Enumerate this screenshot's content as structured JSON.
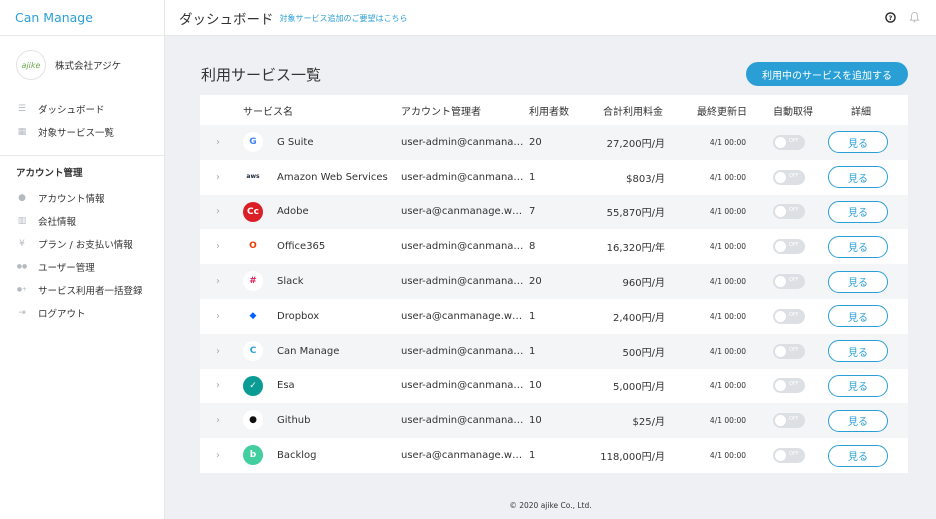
{
  "sidebar": {
    "brand": "Can Manage",
    "company_logo_text": "ajike",
    "company_name": "株式会社アジケ",
    "nav_main": [
      {
        "label": "ダッシュボード",
        "icon": "list-icon"
      },
      {
        "label": "対象サービス一覧",
        "icon": "grid-icon"
      }
    ],
    "account_section_title": "アカウント管理",
    "nav_account": [
      {
        "label": "アカウント情報",
        "icon": "user-icon"
      },
      {
        "label": "会社情報",
        "icon": "building-icon"
      },
      {
        "label": "プラン / お支払い情報",
        "icon": "yen-icon"
      },
      {
        "label": "ユーザー管理",
        "icon": "users-icon"
      },
      {
        "label": "サービス利用者一括登録",
        "icon": "user-plus-icon"
      },
      {
        "label": "ログアウト",
        "icon": "logout-icon"
      }
    ]
  },
  "header": {
    "title": "ダッシュボード",
    "request_link": "対象サービス追加のご要望はこちら",
    "icons": [
      "help-icon",
      "bell-icon"
    ]
  },
  "main": {
    "title": "利用サービス一覧",
    "add_button": "利用中のサービスを追加する",
    "columns": {
      "service": "サービス名",
      "admin": "アカウント管理者",
      "users": "利用者数",
      "price": "合計利用料金",
      "updated": "最終更新日",
      "auto": "自動取得",
      "detail": "詳細"
    },
    "toggle_label": "OFF",
    "detail_label": "見る",
    "rows": [
      {
        "name": "G Suite",
        "icon": "google-icon",
        "icon_char": "G",
        "icon_color": "#4285f4",
        "icon_bg": "#ffffff",
        "admin": "user-admin@canmanage.work",
        "users": "20",
        "price": "27,200円/月",
        "updated": "4/1 00:00"
      },
      {
        "name": "Amazon Web Services",
        "icon": "aws-icon",
        "icon_char": "aws",
        "icon_color": "#232f3e",
        "icon_bg": "#ffffff",
        "admin": "user-admin@canmanage.work",
        "users": "1",
        "price": "$803/月",
        "updated": "4/1 00:00"
      },
      {
        "name": "Adobe",
        "icon": "adobe-icon",
        "icon_char": "Cc",
        "icon_color": "#ffffff",
        "icon_bg": "#da1f26",
        "admin": "user-a@canmanage.work",
        "users": "7",
        "price": "55,870円/月",
        "updated": "4/1 00:00"
      },
      {
        "name": "Office365",
        "icon": "office365-icon",
        "icon_char": "O",
        "icon_color": "#eb3c00",
        "icon_bg": "#ffffff",
        "admin": "user-admin@canmanage.work",
        "users": "8",
        "price": "16,320円/年",
        "updated": "4/1 00:00"
      },
      {
        "name": "Slack",
        "icon": "slack-icon",
        "icon_char": "#",
        "icon_color": "#e01e5a",
        "icon_bg": "#ffffff",
        "admin": "user-admin@canmanage.work",
        "users": "20",
        "price": "960円/月",
        "updated": "4/1 00:00"
      },
      {
        "name": "Dropbox",
        "icon": "dropbox-icon",
        "icon_char": "◆",
        "icon_color": "#0061ff",
        "icon_bg": "#ffffff",
        "admin": "user-a@canmanage.work",
        "users": "1",
        "price": "2,400円/月",
        "updated": "4/1 00:00"
      },
      {
        "name": "Can Manage",
        "icon": "canmanage-icon",
        "icon_char": "C",
        "icon_color": "#2a9fd6",
        "icon_bg": "#ffffff",
        "admin": "user-admin@canmanage.work",
        "users": "1",
        "price": "500円/月",
        "updated": "4/1 00:00"
      },
      {
        "name": "Esa",
        "icon": "esa-icon",
        "icon_char": "✓",
        "icon_color": "#ffffff",
        "icon_bg": "#0a9b94",
        "admin": "user-admin@canmanage.work",
        "users": "10",
        "price": "5,000円/月",
        "updated": "4/1 00:00"
      },
      {
        "name": "Github",
        "icon": "github-icon",
        "icon_char": "●",
        "icon_color": "#111111",
        "icon_bg": "#ffffff",
        "admin": "user-admin@canmanage.work",
        "users": "10",
        "price": "$25/月",
        "updated": "4/1 00:00"
      },
      {
        "name": "Backlog",
        "icon": "backlog-icon",
        "icon_char": "b",
        "icon_color": "#ffffff",
        "icon_bg": "#42ce9f",
        "admin": "user-a@canmanage.work",
        "users": "1",
        "price": "118,000円/月",
        "updated": "4/1 00:00"
      }
    ]
  },
  "footer": "© 2020 ajike Co., Ltd.",
  "colors": {
    "accent": "#2a9fd6",
    "background": "#eef0f3"
  }
}
